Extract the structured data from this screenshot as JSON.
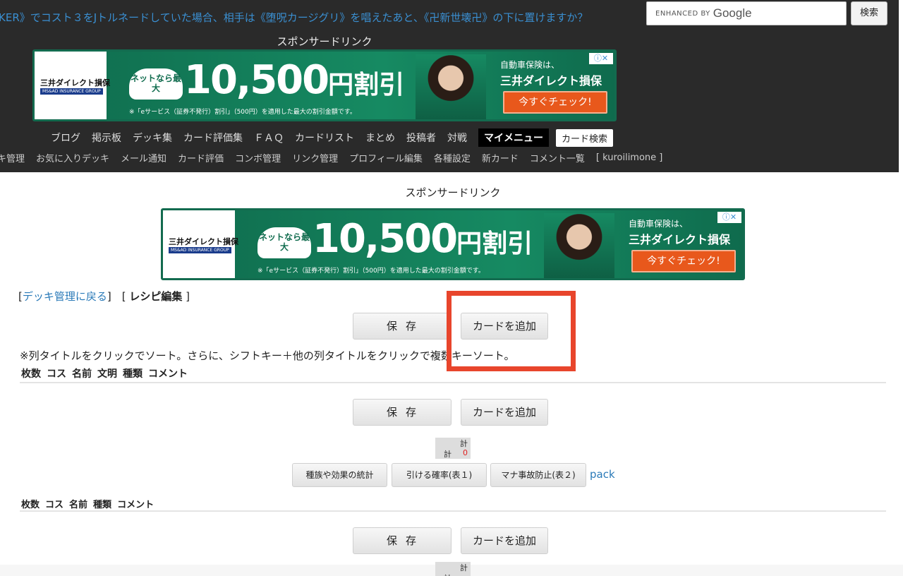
{
  "header": {
    "ticker": "KER》でコスト３をJトルネードしていた場合、相手は《堕呪カージグリ》を唱えたあと、《卍新世壊卍》の下に置けますか？",
    "search_enhanced": "ENHANCED BY",
    "search_google": "Google",
    "search_button": "検索",
    "sponsor": "スポンサードリンク"
  },
  "ad": {
    "logo_name": "三井ダイレクト損保",
    "logo_sub": "MS&AD INSURANCE GROUP",
    "badge": "ネットなら最大",
    "amount": "10,500",
    "unit": "円割引",
    "note": "※「eサービス（証券不発行）割引」（500円）を適用した最大の割引金額です。",
    "right_line1": "自動車保険は、",
    "right_line2": "三井ダイレクト損保",
    "cta": "今すぐチェック!",
    "close": "ⓘ✕"
  },
  "nav1": [
    "ブログ",
    "掲示板",
    "デッキ集",
    "カード評価集",
    "ＦＡＱ",
    "カードリスト",
    "まとめ",
    "投稿者",
    "対戦"
  ],
  "nav1_mymenu": "マイメニュー",
  "nav1_cardsearch": "カード検索",
  "nav2": [
    "キ管理",
    "お気に入りデッキ",
    "メール通知",
    "カード評価",
    "コンボ管理",
    "リンク管理",
    "プロフィール編集",
    "各種設定",
    "新カード",
    "コメント一覧",
    "[ kuroilimone ]"
  ],
  "content": {
    "sponsor": "スポンサードリンク",
    "crumb_open": "[",
    "crumb_link": "デッキ管理に戻る",
    "crumb_mid": "]　[",
    "crumb_current": "レシピ編集",
    "crumb_close": "]",
    "save": "保存",
    "add_card": "カードを追加",
    "hint": "※列タイトルをクリックでソート。さらに、シフトキー＋他の列タイトルをクリックで複数キーソート。",
    "cols1": [
      "枚数",
      "コス",
      "名前",
      "文明",
      "種類",
      "コメント"
    ],
    "cols2": [
      "枚数",
      "コス",
      "名前",
      "種類",
      "コメント"
    ],
    "total_top": "計",
    "total_label": "計",
    "total_value": "0",
    "stats_button": "種族や効果の統計",
    "prob_button": "引ける確率(表１)",
    "mana_button": "マナ事故防止(表２)",
    "pack_link": "pack"
  }
}
